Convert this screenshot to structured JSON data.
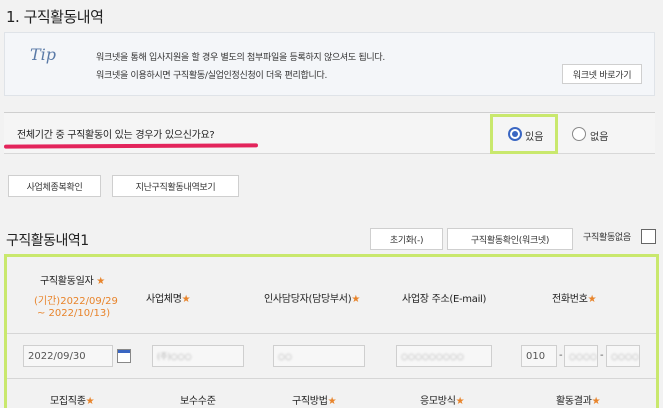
{
  "section": {
    "title": "1. 구직활동내역"
  },
  "tip": {
    "logo": "Tip",
    "line1": "워크넷을 통해 입사지원을 할 경우 별도의 첨부파일을 등록하지 않으셔도 됩니다.",
    "line2": "워크넷을 이용하시면 구직활동/실업인정신청이 더욱 편리합니다.",
    "worknet_button": "워크넷 바로가기"
  },
  "question": {
    "text": "전체기간 중 구직활동이 있는 경우가 있으신가요?",
    "yes_label": "있음",
    "no_label": "없음",
    "selected": "있음"
  },
  "actions": {
    "workplace_check": "사업체종복확인",
    "past_history": "지난구직활동내역보기"
  },
  "activity": {
    "title": "구직활동내역1",
    "reset_button": "초기화(-)",
    "worknet_check_button": "구직활동확인(워크넷)",
    "no_activity_label": "구직활동없음"
  },
  "table": {
    "headers": {
      "date": "구직활동일자",
      "period_line1": "(기간)2022/09/29",
      "period_line2": "~ 2022/10/13)",
      "company": "사업체명",
      "hr": "인사담당자(담당부서)",
      "address": "사업장 주소(E-mail)",
      "phone": "전화번호"
    },
    "row": {
      "date": "2022/09/30",
      "company": "(주)○○○",
      "hr": "○○",
      "address": "○○○○○○○○○",
      "phone1": "010",
      "phone2": "○○○○",
      "phone3": "○○○○"
    },
    "headers2": {
      "job": "모집직종",
      "pay": "보수수준",
      "method": "구직방법",
      "apply": "응모방식",
      "result": "활동결과"
    }
  },
  "colors": {
    "highlight": "#c9e86d",
    "underline": "#e3245b",
    "accent": "#3a66c2",
    "required": "#e8842b"
  }
}
